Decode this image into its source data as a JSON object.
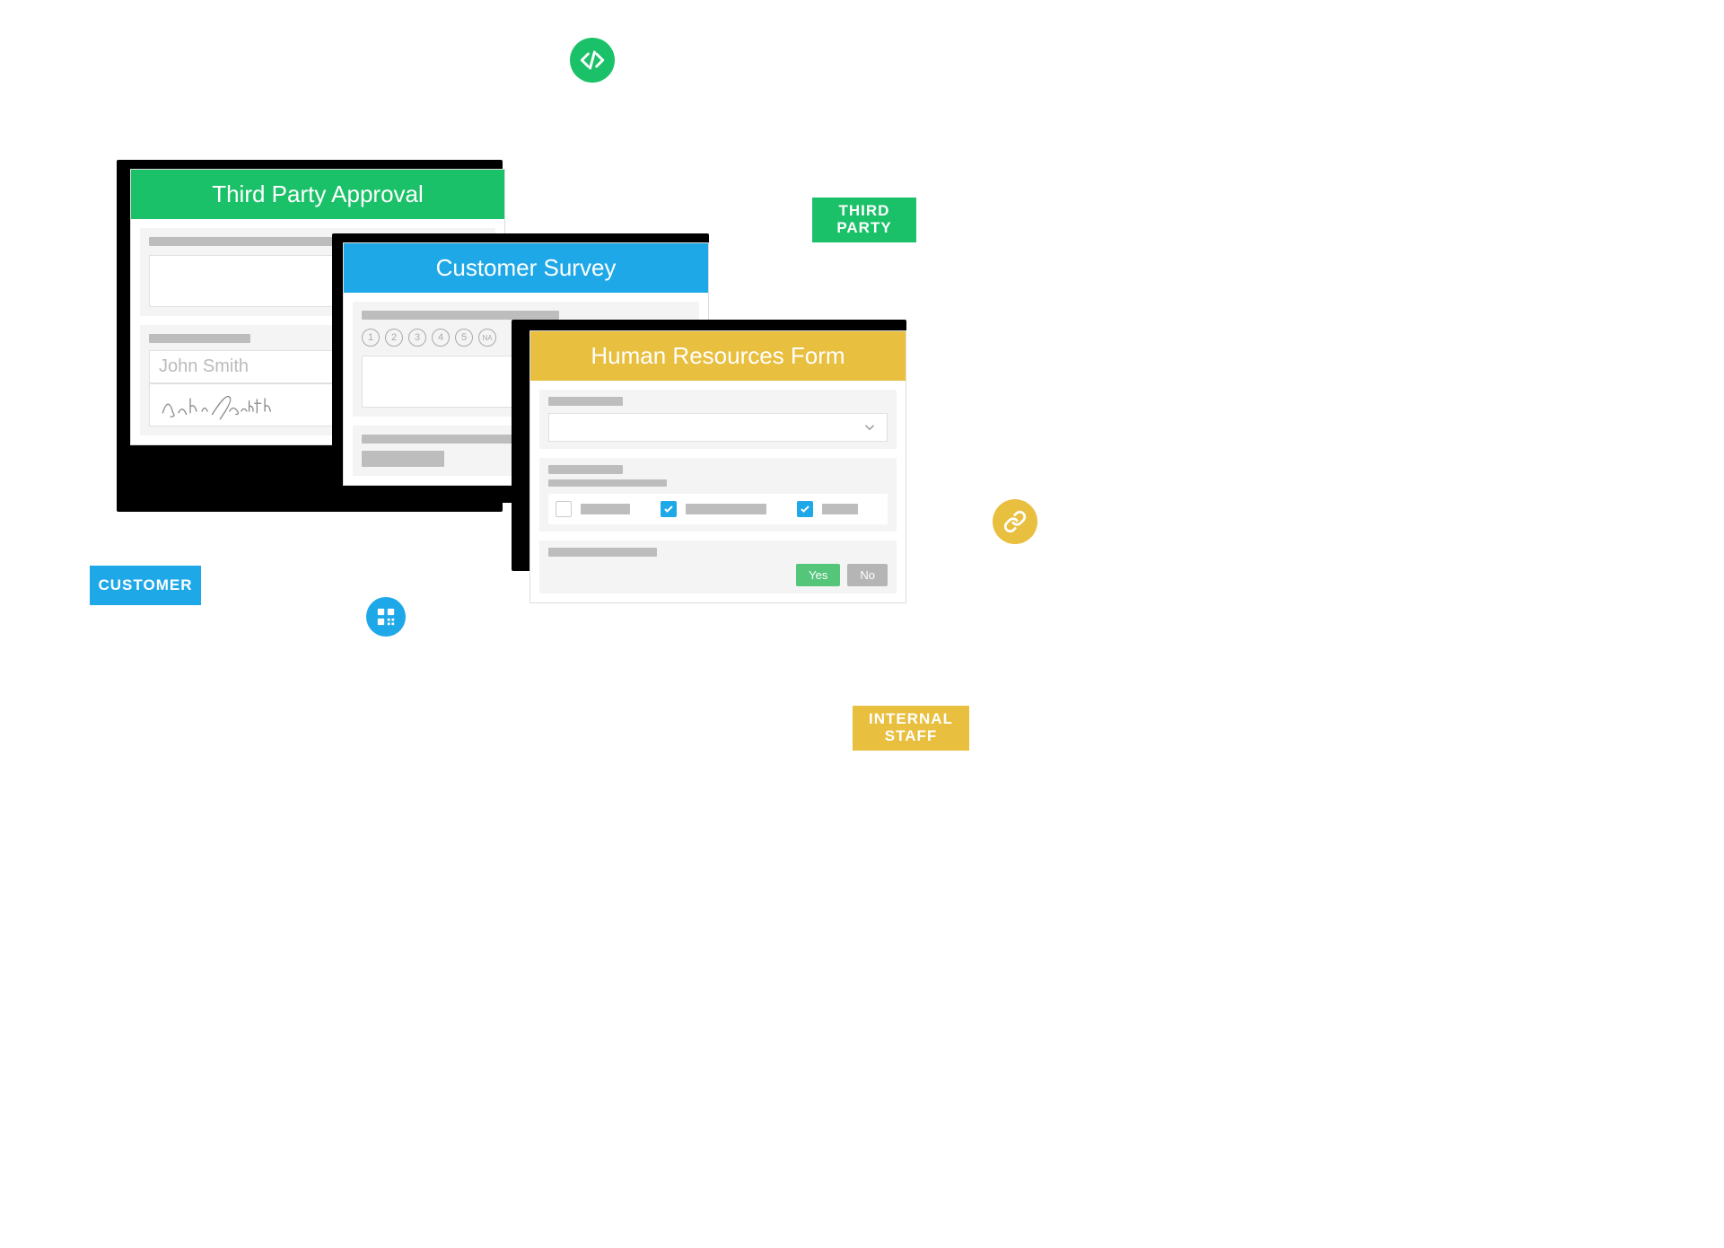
{
  "icons": {
    "code": "code-icon",
    "qr": "qr-code-icon",
    "link": "link-icon"
  },
  "badges": {
    "third_party": {
      "line1": "THIRD",
      "line2": "PARTY"
    },
    "customer": "CUSTOMER",
    "internal_staff": {
      "line1": "INTERNAL",
      "line2": "STAFF"
    }
  },
  "cards": {
    "third_party_approval": {
      "title": "Third Party Approval",
      "signer_name": "John Smith"
    },
    "customer_survey": {
      "title": "Customer Survey",
      "rating_options": [
        "1",
        "2",
        "3",
        "4",
        "5",
        "NA"
      ]
    },
    "hr_form": {
      "title": "Human Resources Form",
      "checkboxes": [
        {
          "checked": false
        },
        {
          "checked": true
        },
        {
          "checked": true
        }
      ],
      "yes_label": "Yes",
      "no_label": "No"
    }
  }
}
